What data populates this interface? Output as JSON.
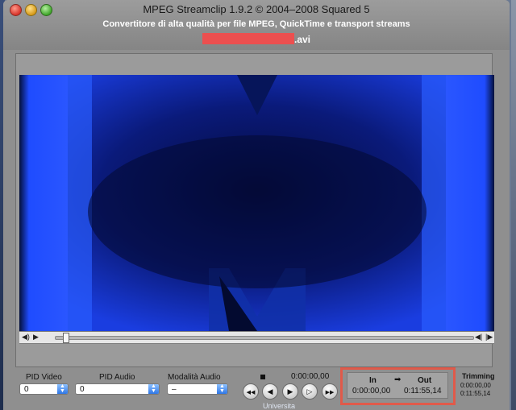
{
  "window": {
    "title": "MPEG Streamclip 1.9.2 © 2004–2008 Squared 5",
    "subtitle": "Convertitore di alta qualità per file MPEG, QuickTime e transport streams",
    "file_extension": ".avi",
    "redaction_color": "#ec4f4f"
  },
  "controls": {
    "pid_video": {
      "label": "PID Video",
      "value": "0"
    },
    "pid_audio": {
      "label": "PID Audio",
      "value": "0"
    },
    "audio_mode": {
      "label": "Modalità Audio",
      "value": "–"
    },
    "current_time": "0:00:00,00",
    "transport": {
      "go_start_icon": "◀◀",
      "prev_frame_icon": "◀",
      "play_icon": "▶",
      "next_frame_icon": "▷",
      "go_end_icon": "▶▶"
    }
  },
  "in_out": {
    "in_label": "In",
    "arrow": "➡",
    "out_label": "Out",
    "in_value": "0:00:00,00",
    "out_value": "0:11:55,14",
    "highlight_color": "#e05a4a"
  },
  "trimming": {
    "label": "Trimming",
    "start": "0:00:00,00",
    "end": "0:11:55,14"
  },
  "desktop": {
    "bottom_text": "Universita"
  },
  "icons": {
    "scrub_left": "volume-icon",
    "scrub_play": "play-small-icon",
    "scrub_right_a": "step-back-icon",
    "scrub_right_b": "step-forward-icon"
  }
}
